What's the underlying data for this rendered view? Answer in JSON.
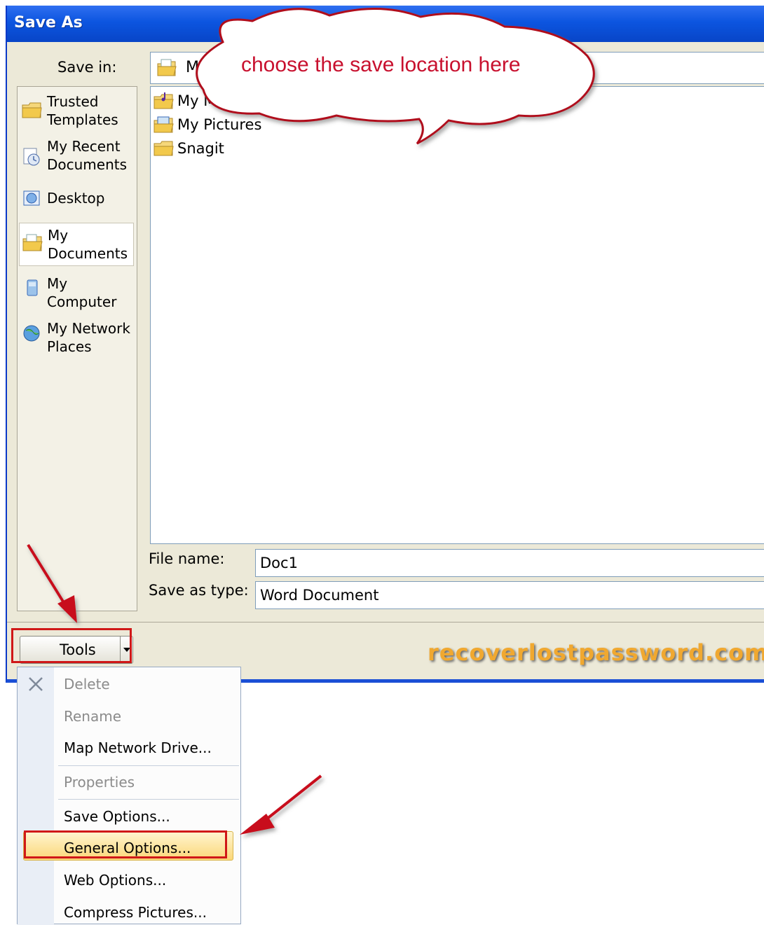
{
  "window": {
    "title": "Save As"
  },
  "save_in": {
    "label": "Save in:",
    "value": "My"
  },
  "places": [
    {
      "line1": "Trusted",
      "line2": "Templates",
      "icon": "folder-icon"
    },
    {
      "line1": "My Recent",
      "line2": "Documents",
      "icon": "recent-documents-icon"
    },
    {
      "line1": "Desktop",
      "line2": "",
      "icon": "desktop-icon"
    },
    {
      "line1": "My",
      "line2": "Documents",
      "icon": "my-documents-icon",
      "selected": true
    },
    {
      "line1": "My",
      "line2": "Computer",
      "icon": "computer-icon"
    },
    {
      "line1": "My Network",
      "line2": "Places",
      "icon": "network-icon"
    }
  ],
  "files": [
    {
      "name": "My Music",
      "icon": "music-folder-icon"
    },
    {
      "name": "My Pictures",
      "icon": "pictures-folder-icon"
    },
    {
      "name": "Snagit",
      "icon": "folder-icon"
    }
  ],
  "file_name": {
    "label": "File name:",
    "value": "Doc1"
  },
  "save_as_type": {
    "label": "Save as type:",
    "value": "Word Document"
  },
  "tools": {
    "label": "Tools"
  },
  "watermark": "recoverlostpassword.com",
  "callout": {
    "text": "choose the save location here"
  },
  "tools_menu": [
    {
      "label": "Delete",
      "disabled": true,
      "icon": "delete-x-icon"
    },
    {
      "label": "Rename",
      "disabled": true
    },
    {
      "label": "Map Network Drive...",
      "disabled": false
    },
    {
      "label": "Properties",
      "disabled": true
    },
    {
      "label": "Save Options...",
      "disabled": false
    },
    {
      "label": "General Options...",
      "disabled": false,
      "highlighted": true
    },
    {
      "label": "Web Options...",
      "disabled": false
    },
    {
      "label": "Compress Pictures...",
      "disabled": false
    }
  ],
  "colors": {
    "titlebar": "#0c55e0",
    "annotation_red": "#d01818",
    "callout_text": "#c8102e",
    "watermark": "#f0a830"
  }
}
